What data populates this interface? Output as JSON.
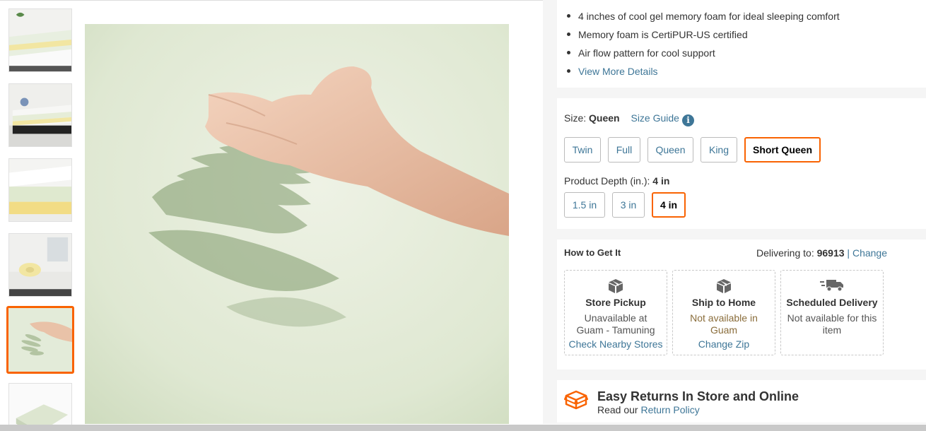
{
  "gallery": {
    "thumbnails": [
      "mattress-topper-bed-view",
      "mattress-on-frame-view",
      "topper-layer-closeup",
      "rolled-topper-view",
      "hand-imprint-foam",
      "foam-cushion-view"
    ],
    "selected_index": 4,
    "main_image": "hand-imprint-foam"
  },
  "highlights": {
    "bullets": [
      "4 inches of cool gel memory foam for ideal sleeping comfort",
      "Memory foam is CertiPUR-US certified",
      "Air flow pattern for cool support"
    ],
    "more_link": "View More Details"
  },
  "size": {
    "label": "Size:",
    "selected": "Queen",
    "guide_link": "Size Guide",
    "info_icon": "i",
    "options": [
      "Twin",
      "Full",
      "Queen",
      "King",
      "Short Queen"
    ],
    "highlighted_option": "Short Queen"
  },
  "depth": {
    "label": "Product Depth (in.):",
    "selected": "4 in",
    "options": [
      "1.5 in",
      "3 in",
      "4 in"
    ]
  },
  "fulfillment": {
    "title": "How to Get It",
    "delivering_label": "Delivering to:",
    "zip": "96913",
    "separator": "|",
    "change_link": "Change",
    "cards": [
      {
        "icon": "store-pickup-box-icon",
        "title": "Store Pickup",
        "line1": "Unavailable at",
        "line2": "Guam - Tamuning",
        "link": "Check Nearby Stores"
      },
      {
        "icon": "ship-to-home-box-icon",
        "title": "Ship to Home",
        "line1": "Not available in Guam",
        "link": "Change Zip"
      },
      {
        "icon": "delivery-truck-icon",
        "title": "Scheduled Delivery",
        "line1": "Not available for this",
        "line2": "item"
      }
    ]
  },
  "returns": {
    "title": "Easy Returns In Store and Online",
    "read_text": "Read our",
    "policy_link": "Return Policy",
    "icon": "return-box-icon"
  },
  "colors": {
    "accent": "#f96302",
    "link": "#3e7697",
    "panel_bg": "#f5f5f5",
    "foam_green": "#dfe8d2",
    "topper_yellow": "#f2e6a2"
  }
}
